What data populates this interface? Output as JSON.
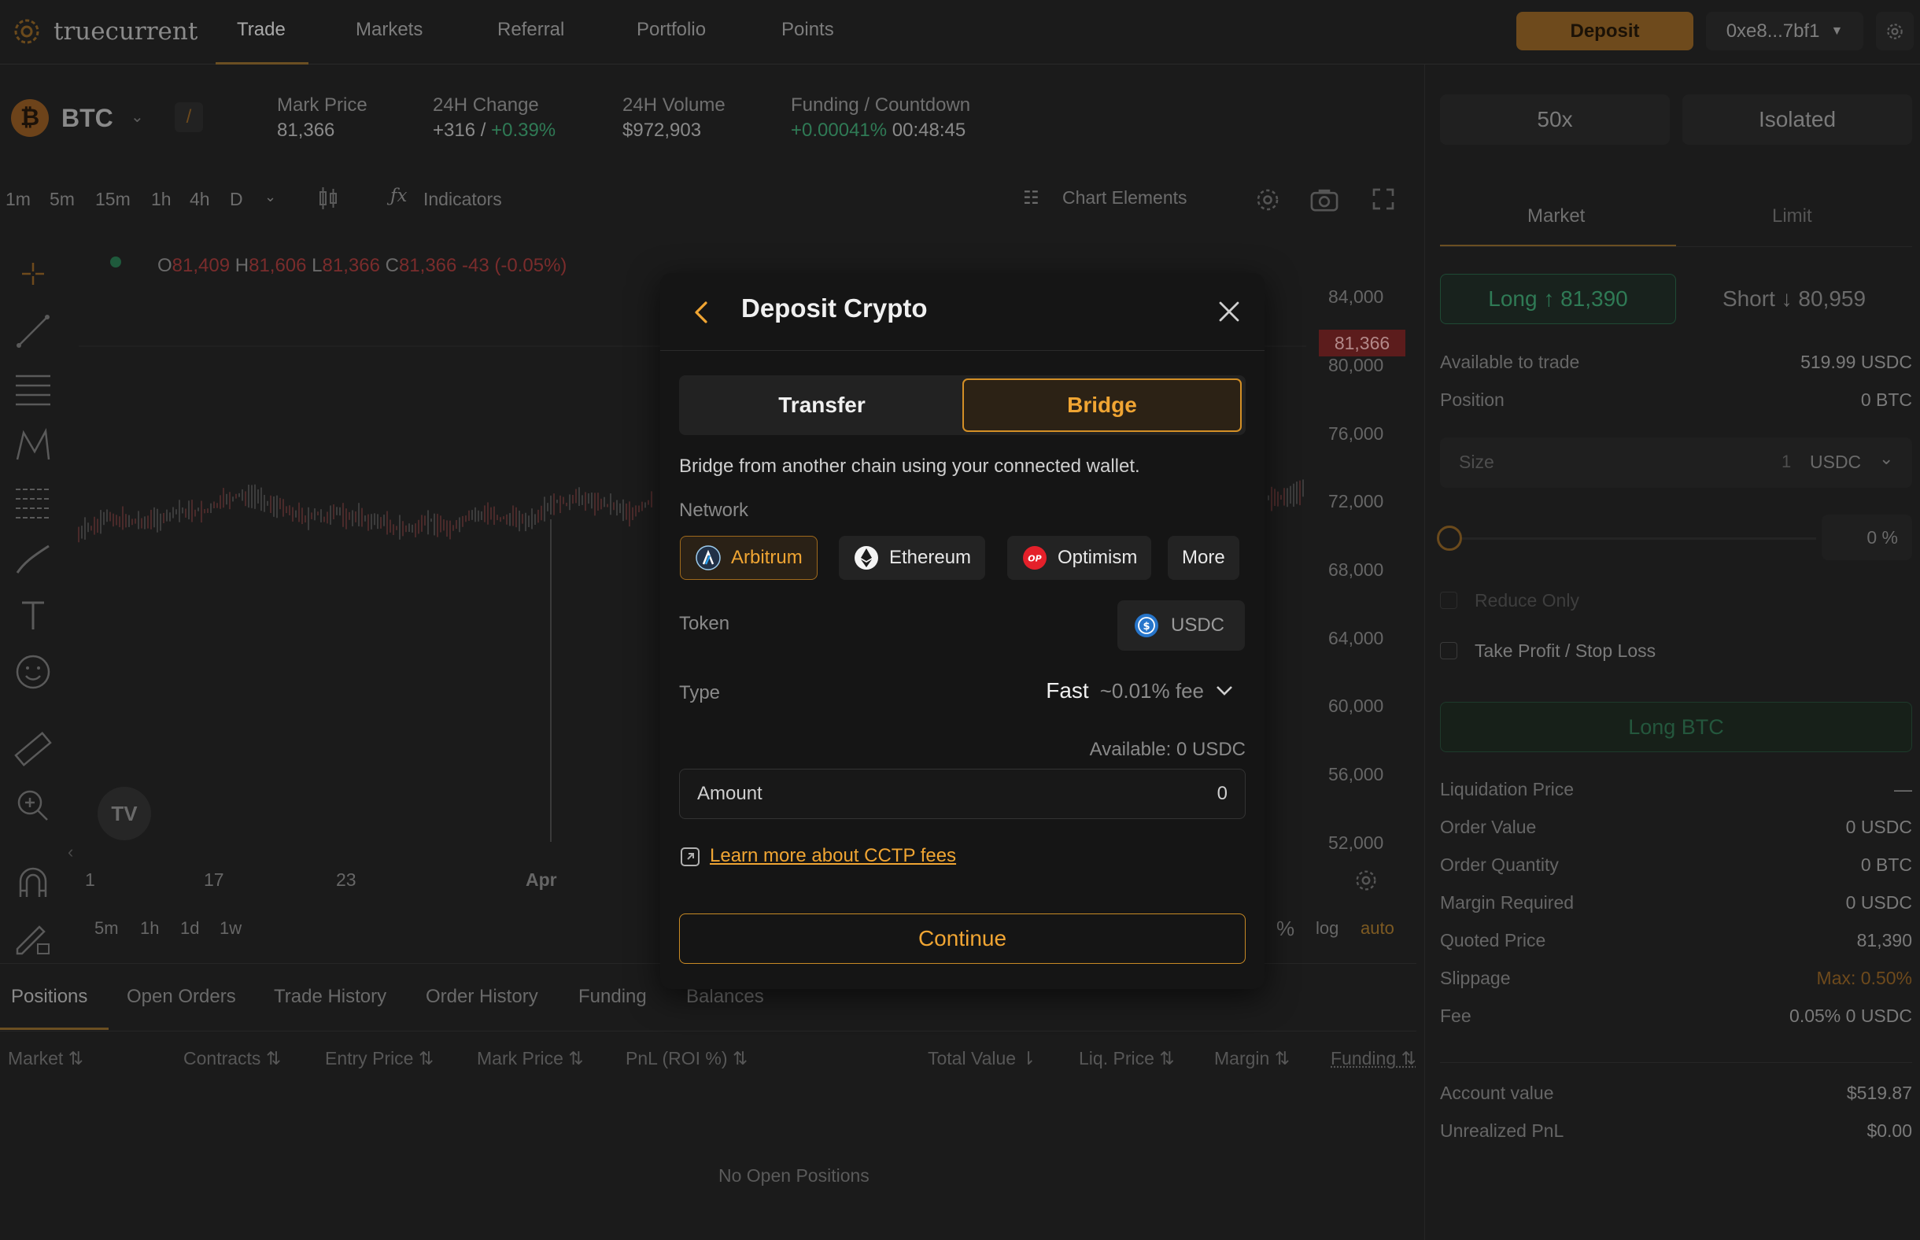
{
  "brand": {
    "name_part1": "true",
    "name_part2": "current"
  },
  "nav": {
    "items": [
      "Trade",
      "Markets",
      "Referral",
      "Portfolio",
      "Points"
    ],
    "active": "Trade"
  },
  "header_actions": {
    "deposit_label": "Deposit",
    "wallet_address": "0xe8...7bf1"
  },
  "ticker": {
    "symbol": "BTC",
    "mark_price_label": "Mark Price",
    "mark_price": "81,366",
    "change_label": "24H Change",
    "change_abs": "+316 /",
    "change_pct": "+0.39%",
    "volume_label": "24H Volume",
    "volume": "$972,903",
    "funding_label": "Funding / Countdown",
    "funding_rate": "+0.00041%",
    "countdown": "00:48:45"
  },
  "chart_toolbar": {
    "timeframes": [
      "1m",
      "5m",
      "15m",
      "1h",
      "4h",
      "D"
    ],
    "active_timeframe": "1h",
    "indicators_label": "Indicators",
    "chart_elements_label": "Chart Elements"
  },
  "ohlc": {
    "o_label": "O",
    "o": "81,409",
    "h_label": "H",
    "h": "81,606",
    "l_label": "L",
    "l": "81,366",
    "c_label": "C",
    "c": "81,366",
    "change": "-43 (-0.05%)"
  },
  "chart": {
    "y_ticks": [
      "84,000",
      "80,000",
      "76,000",
      "72,000",
      "68,000",
      "64,000",
      "60,000",
      "56,000",
      "52,000"
    ],
    "x_ticks": [
      "1",
      "17",
      "23",
      "Apr"
    ],
    "last_price_tag": "81,366",
    "range_buttons": [
      "5m",
      "1h",
      "1d",
      "1w"
    ],
    "scale_buttons": [
      "%",
      "log",
      "auto"
    ]
  },
  "bottom": {
    "tabs": [
      "Positions",
      "Open Orders",
      "Trade History",
      "Order History",
      "Funding",
      "Balances"
    ],
    "columns": [
      "Market",
      "Contracts",
      "Entry Price",
      "Mark Price",
      "PnL (ROI %)",
      "Total Value",
      "Liq. Price",
      "Margin",
      "Funding"
    ],
    "empty_text": "No Open Positions"
  },
  "order_panel": {
    "leverage": "50x",
    "margin_mode": "Isolated",
    "order_tabs": [
      "Market",
      "Limit"
    ],
    "long_label": "Long ↑ 81,390",
    "short_label": "Short ↓ 80,959",
    "available_label": "Available to trade",
    "available_value": "519.99 USDC",
    "position_label": "Position",
    "position_value": "0 BTC",
    "size_placeholder": "Size",
    "size_value": "1",
    "size_unit": "USDC",
    "slider_pct": "0 %",
    "reduce_only": "Reduce Only",
    "tpsl": "Take Profit / Stop Loss",
    "submit_label": "Long BTC",
    "details": [
      {
        "label": "Liquidation Price",
        "value": "—"
      },
      {
        "label": "Order Value",
        "value": "0 USDC"
      },
      {
        "label": "Order Quantity",
        "value": "0 BTC"
      },
      {
        "label": "Margin Required",
        "value": "0 USDC"
      },
      {
        "label": "Quoted Price",
        "value": "81,390"
      },
      {
        "label": "Slippage",
        "value": "Max: 0.50%"
      },
      {
        "label": "Fee",
        "value": "0.05% 0 USDC"
      }
    ],
    "account_value_label": "Account value",
    "account_value": "$519.87",
    "upnl_label": "Unrealized PnL",
    "upnl": "$0.00"
  },
  "modal": {
    "title": "Deposit Crypto",
    "tabs": [
      "Transfer",
      "Bridge"
    ],
    "active_tab": "Bridge",
    "description": "Bridge from another chain using your connected wallet.",
    "network_label": "Network",
    "networks": [
      "Arbitrum",
      "Ethereum",
      "Optimism",
      "More"
    ],
    "selected_network": "Arbitrum",
    "token_label": "Token",
    "token": "USDC",
    "type_label": "Type",
    "type_value": "Fast",
    "type_fee": "~0.01% fee",
    "available": "Available: 0 USDC",
    "amount_label": "Amount",
    "amount_value": "0",
    "learn_more": "Learn more about CCTP fees",
    "continue_label": "Continue"
  },
  "colors": {
    "accent": "#f0a533",
    "green": "#2f7a55",
    "red": "#7a2c2c",
    "modal_bg": "#151515"
  }
}
